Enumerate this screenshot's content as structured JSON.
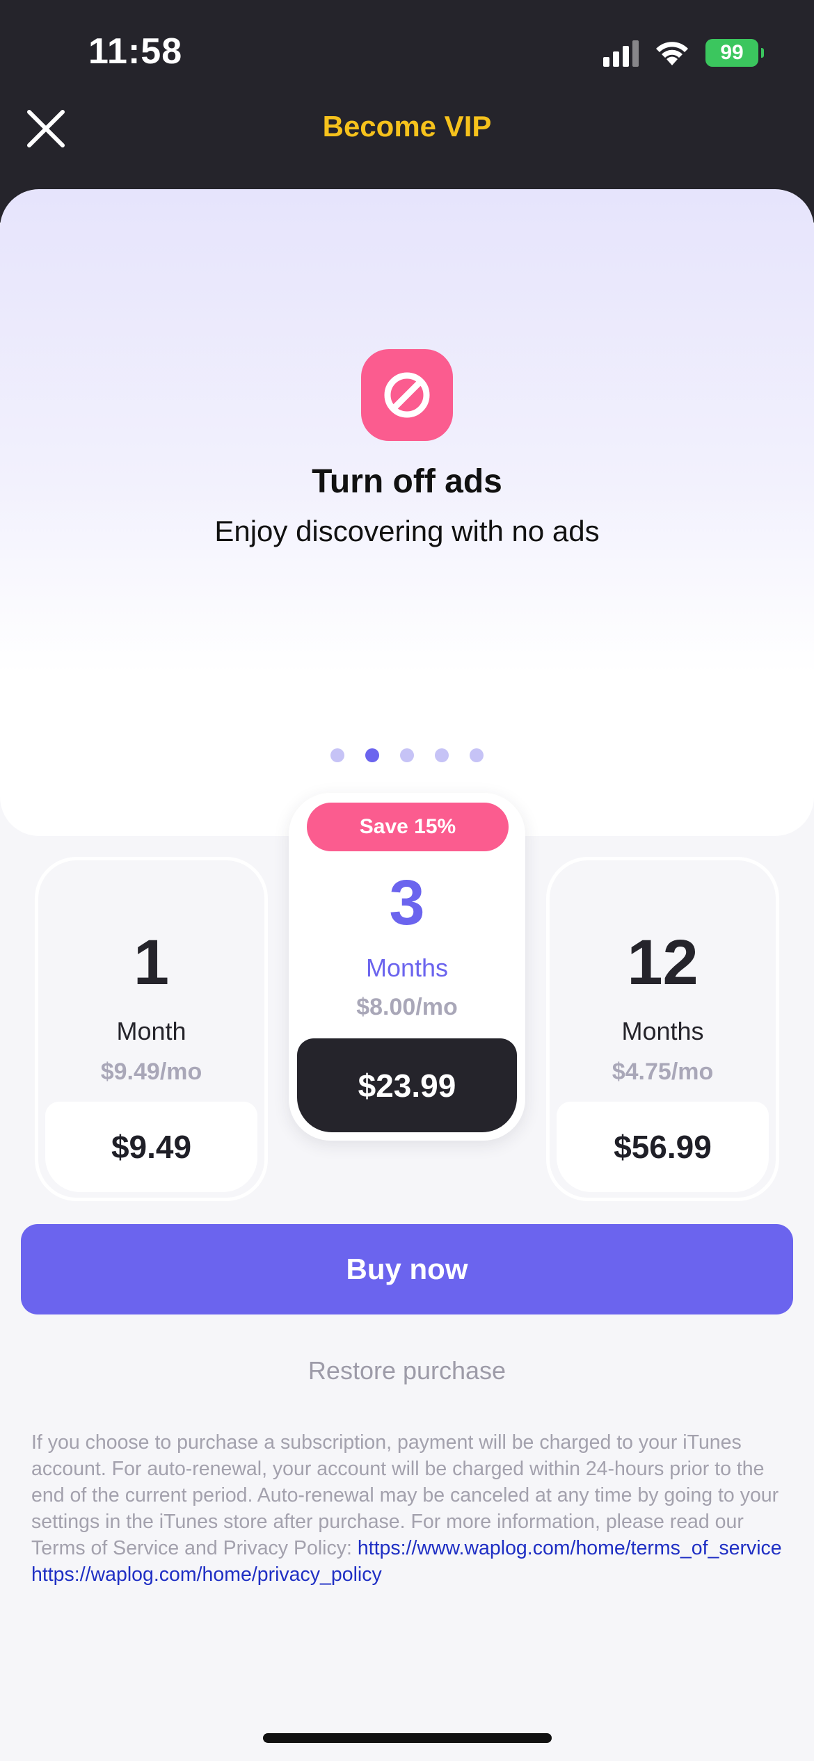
{
  "status_bar": {
    "time": "11:58",
    "battery": "99"
  },
  "header": {
    "title": "Become VIP"
  },
  "feature": {
    "title": "Turn off ads",
    "subtitle": "Enjoy discovering with no ads",
    "icon": "no-ads-icon",
    "page_count": 5,
    "active_index": 1
  },
  "plans": [
    {
      "count": "1",
      "unit": "Month",
      "per_month": "$9.49/mo",
      "price": "$9.49"
    },
    {
      "badge": "Save 15%",
      "count": "3",
      "unit": "Months",
      "per_month": "$8.00/mo",
      "price": "$23.99",
      "selected": true
    },
    {
      "count": "12",
      "unit": "Months",
      "per_month": "$4.75/mo",
      "price": "$56.99"
    }
  ],
  "buy_label": "Buy now",
  "restore_label": "Restore purchase",
  "legal": {
    "text": "If you choose to purchase a subscription, payment will be charged to your iTunes account. For auto-renewal, your account will be charged within 24-hours prior to the end of the current period. Auto-renewal may be canceled at any time by going to your settings in the iTunes store after purchase. For more information, please read our Terms of Service and Privacy Policy: ",
    "terms_link": "https://www.waplog.com/home/terms_of_service",
    "privacy_link": "https://waplog.com/home/privacy_policy"
  },
  "colors": {
    "accent": "#6b64ee",
    "title_yellow": "#f6c21c",
    "pink": "#fb5c8f",
    "dark": "#25242b"
  }
}
